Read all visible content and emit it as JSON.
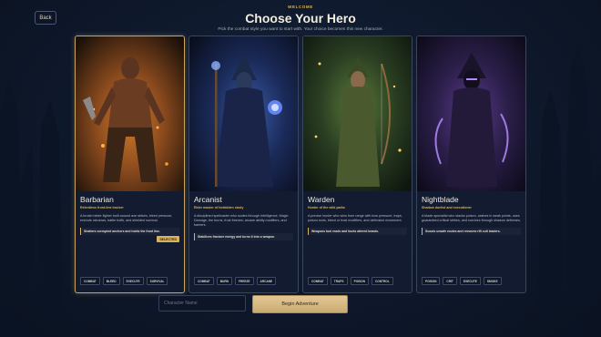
{
  "nav": {
    "back_label": "Back"
  },
  "header": {
    "eyebrow": "WELCOME",
    "title": "Choose Your Hero",
    "subtitle": "Pick the combat style you want to start with. Your choice becomes this new character."
  },
  "selected_badge": "SELECTED",
  "heroes": [
    {
      "name": "Barbarian",
      "tagline": "Relentless front-line bruiser",
      "description": "A brutal melee fighter built around axe strikes, bleed pressure, execute windows, battle buffs, and shielded survival.",
      "note": "Shatters corrupted anchors and holds the front line.",
      "tags": [
        "COMBAT",
        "BLEED",
        "EXECUTE",
        "SURVIVAL"
      ],
      "selected": true,
      "palette": [
        "#3a2410",
        "#8a4a1e",
        "#d07a2a"
      ]
    },
    {
      "name": "Arcanist",
      "tagline": "Elder master of forbidden study",
      "description": "A disciplined spellcaster who scales through Intelligence, Magic Damage, fire burns, frost freezes, arcane ability modifiers, and barriers.",
      "note": "Stabilizes fracture energy and turns it into a weapon.",
      "tags": [
        "COMBAT",
        "BURN",
        "FREEZE",
        "ARCANE"
      ],
      "selected": false,
      "palette": [
        "#0f1d38",
        "#243c78",
        "#5b7ad9"
      ]
    },
    {
      "name": "Warden",
      "tagline": "Hunter of the wild paths",
      "description": "A precise hunter who wins from range with bow pressure, traps, poison tools, bleed or frost modifiers, and defensive movement.",
      "note": "Weapons tool reads and hunts altered beasts.",
      "tags": [
        "COMBAT",
        "TRAPS",
        "POISON",
        "CONTROL"
      ],
      "selected": false,
      "palette": [
        "#182818",
        "#3a5a2a",
        "#c9a040"
      ]
    },
    {
      "name": "Nightblade",
      "tagline": "Shadow duelist and executioner",
      "description": "A blade specialist who stacks poison, cashes in weak points, uses guaranteed critical strikes, and survives through shadow defenses.",
      "note": "Scouts unsafe routes and removes rift cult leaders.",
      "tags": [
        "POISON",
        "CRIT",
        "EXECUTE",
        "SMOKE"
      ],
      "selected": false,
      "palette": [
        "#1a1430",
        "#3a2a5c",
        "#8a5acf"
      ]
    }
  ],
  "form": {
    "name_placeholder": "Character Name",
    "begin_label": "Begin Adventure"
  }
}
